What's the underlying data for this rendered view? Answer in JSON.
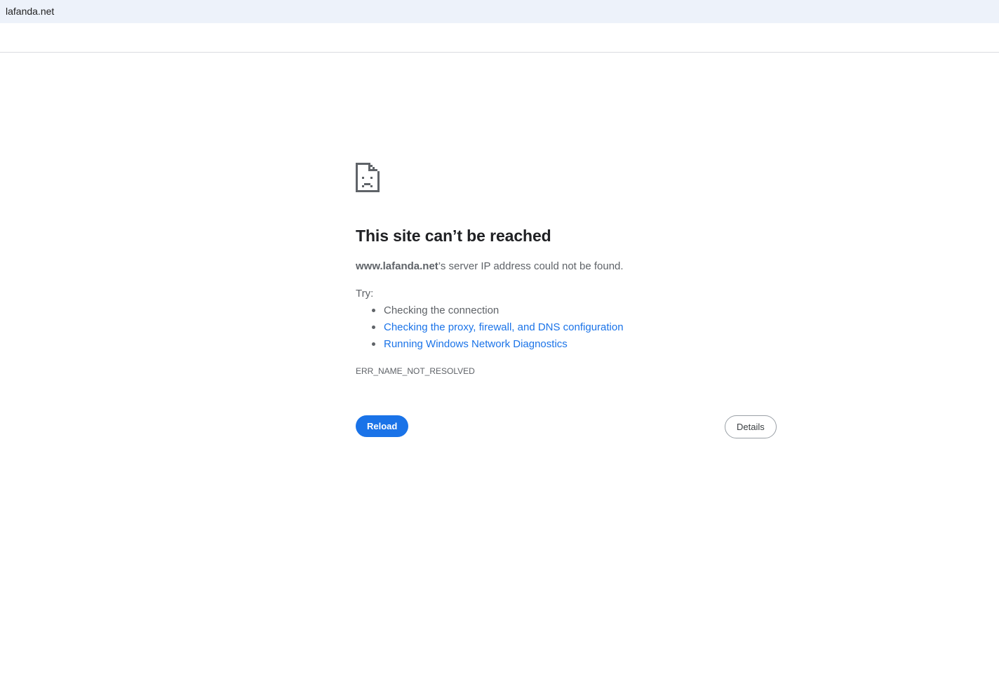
{
  "browser": {
    "tab_title": "lafanda.net"
  },
  "error_page": {
    "icon": "sad-page-icon",
    "title": "This site can’t be reached",
    "host": "www.lafanda.net",
    "summary_suffix": "’s server IP address could not be found.",
    "try_label": "Try:",
    "suggestions": [
      {
        "label": "Checking the connection",
        "is_link": false
      },
      {
        "label": "Checking the proxy, firewall, and DNS configuration",
        "is_link": true
      },
      {
        "label": "Running Windows Network Diagnostics",
        "is_link": true
      }
    ],
    "error_code": "ERR_NAME_NOT_RESOLVED",
    "reload_label": "Reload",
    "details_label": "Details"
  },
  "colors": {
    "accent": "#1a73e8",
    "text_primary": "#202124",
    "text_secondary": "#5f6368",
    "topbar_bg": "#edf2fa"
  }
}
